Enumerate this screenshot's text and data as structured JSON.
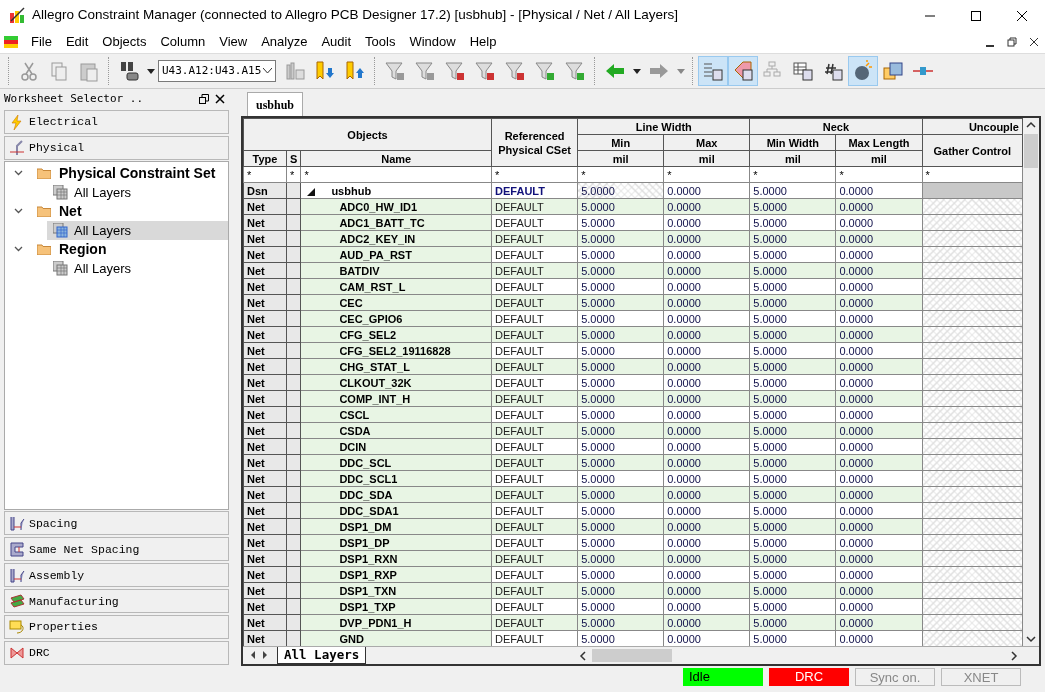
{
  "window": {
    "title": "Allegro Constraint Manager (connected to Allegro PCB Designer 17.2) [usbhub] - [Physical / Net / All Layers]"
  },
  "menu": [
    "File",
    "Edit",
    "Objects",
    "Column",
    "View",
    "Analyze",
    "Audit",
    "Tools",
    "Window",
    "Help"
  ],
  "toolbar": {
    "net_field": "U43.A12:U43.A15",
    "toggles": [
      {
        "on": true
      },
      {
        "on": true
      },
      {
        "on": false
      },
      {
        "on": false
      },
      {
        "on": false
      },
      {
        "on": true
      },
      {
        "on": false
      },
      {
        "on": false
      }
    ]
  },
  "worksheet_selector": {
    "title": "Worksheet Selector ..",
    "top_domains": [
      "Electrical",
      "Physical"
    ],
    "tree": [
      {
        "label": "Physical Constraint Set",
        "expanded": true,
        "children": [
          {
            "label": "All Layers",
            "selected": false
          }
        ]
      },
      {
        "label": "Net",
        "expanded": true,
        "children": [
          {
            "label": "All Layers",
            "selected": true
          }
        ]
      },
      {
        "label": "Region",
        "expanded": true,
        "children": [
          {
            "label": "All Layers",
            "selected": false
          }
        ]
      }
    ],
    "bottom_domains": [
      "Spacing",
      "Same Net Spacing",
      "Assembly",
      "Manufacturing",
      "Properties",
      "DRC"
    ]
  },
  "document_tab": "usbhub",
  "grid": {
    "objects": "Objects",
    "cset": "Referenced Physical CSet",
    "object_columns": [
      "Type",
      "S",
      "Name"
    ],
    "groups": [
      {
        "label": "Line Width",
        "columns": [
          {
            "label": "Min",
            "unit": "mil"
          },
          {
            "label": "Max",
            "unit": "mil"
          }
        ]
      },
      {
        "label": "Neck",
        "columns": [
          {
            "label": "Min Width",
            "unit": "mil"
          },
          {
            "label": "Max Length",
            "unit": "mil"
          }
        ]
      },
      {
        "label": "Uncouple",
        "columns": [
          {
            "label": "Gather Control"
          }
        ]
      }
    ],
    "filters": [
      "*",
      "*",
      "*",
      "*",
      "*",
      "*",
      "*",
      "*",
      "*"
    ],
    "rows": [
      {
        "type": "Dsn",
        "name": "usbhub",
        "expanded": true,
        "cset": "DEFAULT",
        "values": [
          "5.0000",
          "0.0000",
          "5.0000",
          "0.0000"
        ]
      },
      {
        "type": "Net",
        "name": "ADC0_HW_ID1",
        "cset": "DEFAULT",
        "values": [
          "5.0000",
          "0.0000",
          "5.0000",
          "0.0000"
        ]
      },
      {
        "type": "Net",
        "name": "ADC1_BATT_TC",
        "cset": "DEFAULT",
        "values": [
          "5.0000",
          "0.0000",
          "5.0000",
          "0.0000"
        ]
      },
      {
        "type": "Net",
        "name": "ADC2_KEY_IN",
        "cset": "DEFAULT",
        "values": [
          "5.0000",
          "0.0000",
          "5.0000",
          "0.0000"
        ]
      },
      {
        "type": "Net",
        "name": "AUD_PA_RST",
        "cset": "DEFAULT",
        "values": [
          "5.0000",
          "0.0000",
          "5.0000",
          "0.0000"
        ]
      },
      {
        "type": "Net",
        "name": "BATDIV",
        "cset": "DEFAULT",
        "values": [
          "5.0000",
          "0.0000",
          "5.0000",
          "0.0000"
        ]
      },
      {
        "type": "Net",
        "name": "CAM_RST_L",
        "cset": "DEFAULT",
        "values": [
          "5.0000",
          "0.0000",
          "5.0000",
          "0.0000"
        ]
      },
      {
        "type": "Net",
        "name": "CEC",
        "cset": "DEFAULT",
        "values": [
          "5.0000",
          "0.0000",
          "5.0000",
          "0.0000"
        ]
      },
      {
        "type": "Net",
        "name": "CEC_GPIO6",
        "cset": "DEFAULT",
        "values": [
          "5.0000",
          "0.0000",
          "5.0000",
          "0.0000"
        ]
      },
      {
        "type": "Net",
        "name": "CFG_SEL2",
        "cset": "DEFAULT",
        "values": [
          "5.0000",
          "0.0000",
          "5.0000",
          "0.0000"
        ]
      },
      {
        "type": "Net",
        "name": "CFG_SEL2_19116828",
        "cset": "DEFAULT",
        "values": [
          "5.0000",
          "0.0000",
          "5.0000",
          "0.0000"
        ]
      },
      {
        "type": "Net",
        "name": "CHG_STAT_L",
        "cset": "DEFAULT",
        "values": [
          "5.0000",
          "0.0000",
          "5.0000",
          "0.0000"
        ]
      },
      {
        "type": "Net",
        "name": "CLKOUT_32K",
        "cset": "DEFAULT",
        "values": [
          "5.0000",
          "0.0000",
          "5.0000",
          "0.0000"
        ]
      },
      {
        "type": "Net",
        "name": "COMP_INT_H",
        "cset": "DEFAULT",
        "values": [
          "5.0000",
          "0.0000",
          "5.0000",
          "0.0000"
        ]
      },
      {
        "type": "Net",
        "name": "CSCL",
        "cset": "DEFAULT",
        "values": [
          "5.0000",
          "0.0000",
          "5.0000",
          "0.0000"
        ]
      },
      {
        "type": "Net",
        "name": "CSDA",
        "cset": "DEFAULT",
        "values": [
          "5.0000",
          "0.0000",
          "5.0000",
          "0.0000"
        ]
      },
      {
        "type": "Net",
        "name": "DCIN",
        "cset": "DEFAULT",
        "values": [
          "5.0000",
          "0.0000",
          "5.0000",
          "0.0000"
        ]
      },
      {
        "type": "Net",
        "name": "DDC_SCL",
        "cset": "DEFAULT",
        "values": [
          "5.0000",
          "0.0000",
          "5.0000",
          "0.0000"
        ]
      },
      {
        "type": "Net",
        "name": "DDC_SCL1",
        "cset": "DEFAULT",
        "values": [
          "5.0000",
          "0.0000",
          "5.0000",
          "0.0000"
        ]
      },
      {
        "type": "Net",
        "name": "DDC_SDA",
        "cset": "DEFAULT",
        "values": [
          "5.0000",
          "0.0000",
          "5.0000",
          "0.0000"
        ]
      },
      {
        "type": "Net",
        "name": "DDC_SDA1",
        "cset": "DEFAULT",
        "values": [
          "5.0000",
          "0.0000",
          "5.0000",
          "0.0000"
        ]
      },
      {
        "type": "Net",
        "name": "DSP1_DM",
        "cset": "DEFAULT",
        "values": [
          "5.0000",
          "0.0000",
          "5.0000",
          "0.0000"
        ]
      },
      {
        "type": "Net",
        "name": "DSP1_DP",
        "cset": "DEFAULT",
        "values": [
          "5.0000",
          "0.0000",
          "5.0000",
          "0.0000"
        ]
      },
      {
        "type": "Net",
        "name": "DSP1_RXN",
        "cset": "DEFAULT",
        "values": [
          "5.0000",
          "0.0000",
          "5.0000",
          "0.0000"
        ]
      },
      {
        "type": "Net",
        "name": "DSP1_RXP",
        "cset": "DEFAULT",
        "values": [
          "5.0000",
          "0.0000",
          "5.0000",
          "0.0000"
        ]
      },
      {
        "type": "Net",
        "name": "DSP1_TXN",
        "cset": "DEFAULT",
        "values": [
          "5.0000",
          "0.0000",
          "5.0000",
          "0.0000"
        ]
      },
      {
        "type": "Net",
        "name": "DSP1_TXP",
        "cset": "DEFAULT",
        "values": [
          "5.0000",
          "0.0000",
          "5.0000",
          "0.0000"
        ]
      },
      {
        "type": "Net",
        "name": "DVP_PDN1_H",
        "cset": "DEFAULT",
        "values": [
          "5.0000",
          "0.0000",
          "5.0000",
          "0.0000"
        ]
      },
      {
        "type": "Net",
        "name": "GND",
        "cset": "DEFAULT",
        "values": [
          "5.0000",
          "0.0000",
          "5.0000",
          "0.0000"
        ]
      }
    ]
  },
  "sheet_tab": "All Layers",
  "status": [
    {
      "text": "Idle",
      "kind": "ok"
    },
    {
      "text": "DRC",
      "kind": "alert"
    },
    {
      "text": "Sync on.",
      "kind": "dim"
    },
    {
      "text": "XNET",
      "kind": "dim"
    }
  ]
}
